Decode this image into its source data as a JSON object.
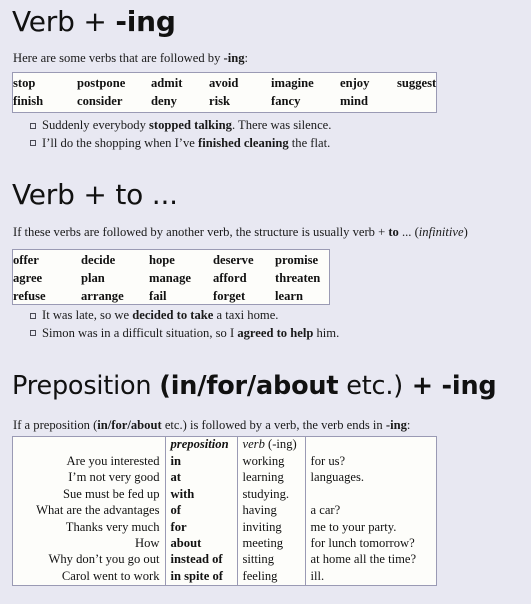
{
  "page": {
    "background_color": "#e8e8f2",
    "box_background_color": "#fdfdfa",
    "box_border_color": "#9a9ab4",
    "text_color": "#111111"
  },
  "sections": {
    "verb_ing": {
      "heading_prefix": "Verb + ",
      "heading_bold": "-ing",
      "intro_prefix": "Here are some verbs that are followed by ",
      "intro_bold": "-ing",
      "intro_suffix": ":",
      "verbs_row1": [
        "stop",
        "postpone",
        "admit",
        "avoid",
        "imagine",
        "enjoy",
        "suggest"
      ],
      "verbs_row2": [
        "finish",
        "consider",
        "deny",
        "risk",
        "fancy",
        "mind",
        ""
      ],
      "examples": [
        {
          "parts": [
            {
              "text": "Suddenly everybody ",
              "bold": false
            },
            {
              "text": "stopped talking",
              "bold": true
            },
            {
              "text": ". There was silence.",
              "bold": false
            }
          ]
        },
        {
          "parts": [
            {
              "text": "I’ll do the shopping when I’ve ",
              "bold": false
            },
            {
              "text": "finished cleaning",
              "bold": true
            },
            {
              "text": " the flat.",
              "bold": false
            }
          ]
        }
      ]
    },
    "verb_to": {
      "heading": "Verb + to ...",
      "intro_parts": [
        {
          "text": "If these verbs are followed by another verb, the structure is usually verb + ",
          "style": "normal"
        },
        {
          "text": "to",
          "style": "bold"
        },
        {
          "text": " ... (",
          "style": "normal"
        },
        {
          "text": "infinitive",
          "style": "italic"
        },
        {
          "text": ")",
          "style": "normal"
        }
      ],
      "verbs_row1": [
        "offer",
        "decide",
        "hope",
        "deserve",
        "promise"
      ],
      "verbs_row2": [
        "agree",
        "plan",
        "manage",
        "afford",
        "threaten"
      ],
      "verbs_row3": [
        "refuse",
        "arrange",
        "fail",
        "forget",
        "learn"
      ],
      "examples": [
        {
          "parts": [
            {
              "text": "It was late, so we ",
              "bold": false
            },
            {
              "text": "decided to take",
              "bold": true
            },
            {
              "text": " a taxi home.",
              "bold": false
            }
          ]
        },
        {
          "parts": [
            {
              "text": "Simon was in a difficult situation, so I ",
              "bold": false
            },
            {
              "text": "agreed to help",
              "bold": true
            },
            {
              "text": " him.",
              "bold": false
            }
          ]
        }
      ]
    },
    "preposition_ing": {
      "heading_parts": [
        {
          "text": "Preposition ",
          "bold": false
        },
        {
          "text": "(in/for/about",
          "bold": true
        },
        {
          "text": " etc.)",
          "bold": false
        },
        {
          "text": " + -ing",
          "bold": true
        }
      ],
      "intro_parts": [
        {
          "text": "If a preposition (",
          "bold": false
        },
        {
          "text": "in/for/about",
          "bold": true
        },
        {
          "text": " etc.) is followed by a verb, the verb ends in ",
          "bold": false
        },
        {
          "text": "-ing",
          "bold": true
        },
        {
          "text": ":",
          "bold": false
        }
      ],
      "column_headers": {
        "clause": "",
        "preposition": "preposition",
        "verb_italic": "verb",
        "verb_suffix": " (-ing)",
        "complement": ""
      },
      "rows": [
        {
          "clause": "Are you interested",
          "preposition": "in",
          "verb": "working",
          "complement": "for us?"
        },
        {
          "clause": "I’m not very good",
          "preposition": "at",
          "verb": "learning",
          "complement": "languages."
        },
        {
          "clause": "Sue must be fed up",
          "preposition": "with",
          "verb": "studying.",
          "complement": ""
        },
        {
          "clause": "What are the advantages",
          "preposition": "of",
          "verb": "having",
          "complement": "a car?"
        },
        {
          "clause": "Thanks very much",
          "preposition": "for",
          "verb": "inviting",
          "complement": "me to your party."
        },
        {
          "clause": "How",
          "preposition": "about",
          "verb": "meeting",
          "complement": "for lunch tomorrow?"
        },
        {
          "clause": "Why don’t you go out",
          "preposition": "instead of",
          "verb": "sitting",
          "complement": "at home all the time?"
        },
        {
          "clause": "Carol went to work",
          "preposition": "in spite of",
          "verb": "feeling",
          "complement": "ill."
        }
      ]
    }
  }
}
